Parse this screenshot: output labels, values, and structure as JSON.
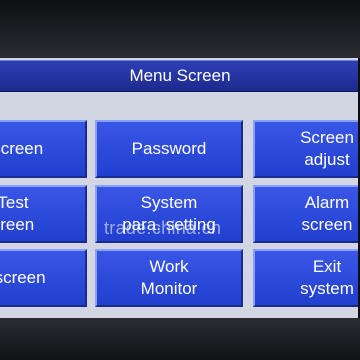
{
  "screen": {
    "title": "Menu Screen"
  },
  "menu": {
    "row1": {
      "col1": [
        "t screen"
      ],
      "col2": [
        "Password"
      ],
      "col3": [
        "Screen",
        "adjust"
      ]
    },
    "row2": {
      "col1": [
        "Test",
        "creen"
      ],
      "col2": [
        "System",
        "para. setting"
      ],
      "col3": [
        "Alarm",
        "screen"
      ]
    },
    "row3": {
      "col1": [
        "p screen"
      ],
      "col2": [
        "Work",
        "Monitor"
      ],
      "col3": [
        "Exit",
        "system"
      ]
    }
  },
  "watermark": "trade.china.cn",
  "colors": {
    "title_bar": "#1c2a8c",
    "button": "#2e4be0",
    "screen_bg": "#d2d6e2"
  }
}
